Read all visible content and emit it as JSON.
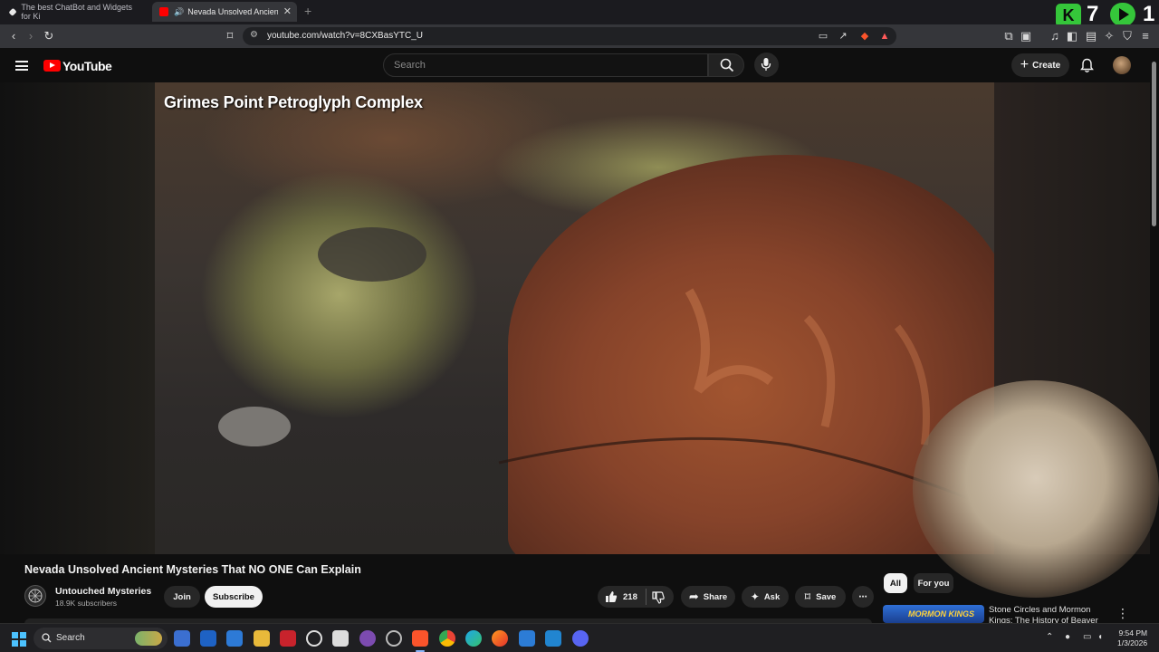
{
  "browser": {
    "tabs": [
      {
        "title": "The best ChatBot and Widgets for Ki",
        "active": false
      },
      {
        "title": "Nevada Unsolved Ancient My",
        "active": true
      }
    ],
    "new_tab_glyph": "+",
    "close_glyph": "✕",
    "url": "youtube.com/watch?v=8CXBasYTC_U",
    "overlay": {
      "left_number": "7",
      "right_number": "1",
      "k_glyph": "K"
    },
    "colors": {
      "tabbar": "#1b1b1f",
      "toolbar": "#35363a",
      "overlay_green": "#35c63a"
    }
  },
  "youtube": {
    "logo_text": "YouTube",
    "search_placeholder": "Search",
    "create_label": "Create",
    "video": {
      "overlay_title": "Grimes Point Petroglyph Complex",
      "heading": "Nevada Unsolved Ancient Mysteries That NO ONE Can Explain"
    },
    "channel": {
      "name": "Untouched Mysteries",
      "subscribers": "18.9K subscribers",
      "join_label": "Join",
      "subscribe_label": "Subscribe"
    },
    "actions": {
      "like_count": "218",
      "share_label": "Share",
      "ask_label": "Ask",
      "save_label": "Save",
      "more_glyph": "⋯"
    },
    "chips": {
      "all": "All",
      "for_you": "For you"
    },
    "recommendation": {
      "thumb_text": "MORMON KINGS",
      "title": "Stone Circles and Mormon Kings: The History of Beaver"
    }
  },
  "taskbar": {
    "search_placeholder": "Search",
    "time": "9:54 PM",
    "date": "1/3/2026",
    "app_icons": [
      "widgets-icon",
      "chatbot-icon",
      "outlook-icon",
      "app-icon",
      "file-explorer-icon",
      "news-icon",
      "clock-icon",
      "terminal-icon",
      "tor-icon",
      "git-icon",
      "brave-icon",
      "chrome-icon",
      "edge-icon",
      "firefox-icon",
      "infinity-icon",
      "vscode-icon",
      "discord-icon"
    ]
  }
}
